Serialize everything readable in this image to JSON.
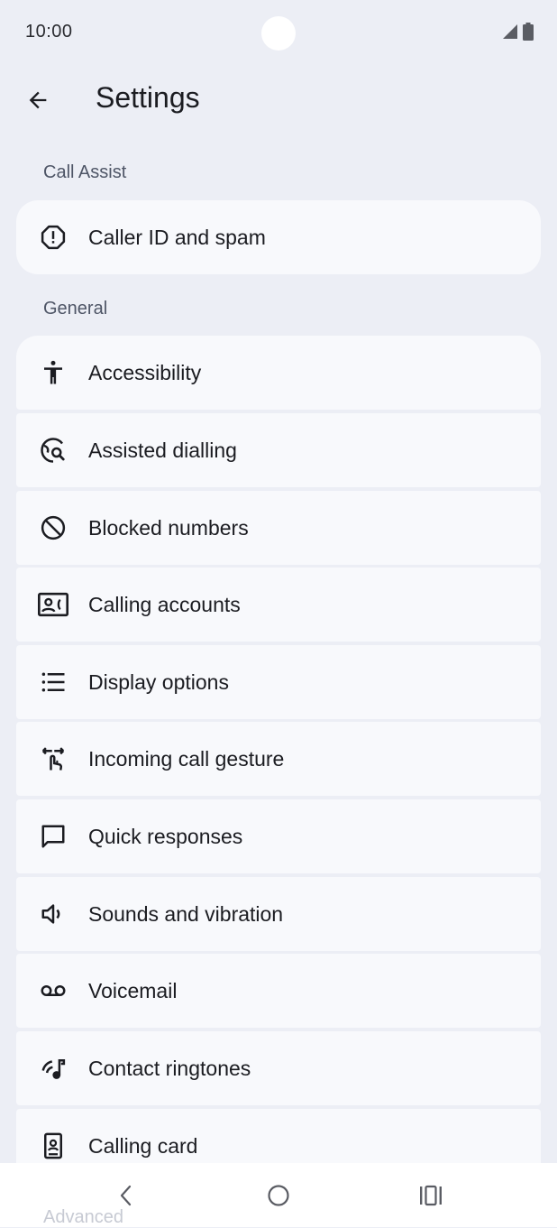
{
  "status": {
    "time": "10:00"
  },
  "app_bar": {
    "title": "Settings",
    "back_icon": "arrow-back-icon"
  },
  "sections": {
    "call_assist": "Call Assist",
    "general": "General",
    "advanced": "Advanced"
  },
  "call_assist_items": [
    {
      "label": "Caller ID and spam",
      "icon": "spam-alert-icon"
    }
  ],
  "general_items": [
    {
      "label": "Accessibility",
      "icon": "accessibility-icon"
    },
    {
      "label": "Assisted dialling",
      "icon": "assisted-dialling-icon"
    },
    {
      "label": "Blocked numbers",
      "icon": "block-icon"
    },
    {
      "label": "Calling accounts",
      "icon": "calling-accounts-icon"
    },
    {
      "label": "Display options",
      "icon": "list-icon"
    },
    {
      "label": "Incoming call gesture",
      "icon": "gesture-icon"
    },
    {
      "label": "Quick responses",
      "icon": "message-icon"
    },
    {
      "label": "Sounds and vibration",
      "icon": "volume-icon"
    },
    {
      "label": "Voicemail",
      "icon": "voicemail-icon"
    },
    {
      "label": "Contact ringtones",
      "icon": "ringtone-icon"
    },
    {
      "label": "Calling card",
      "icon": "calling-card-icon"
    }
  ],
  "nav": {
    "back": "nav-back-icon",
    "home": "nav-home-icon",
    "recents": "nav-recents-icon"
  }
}
